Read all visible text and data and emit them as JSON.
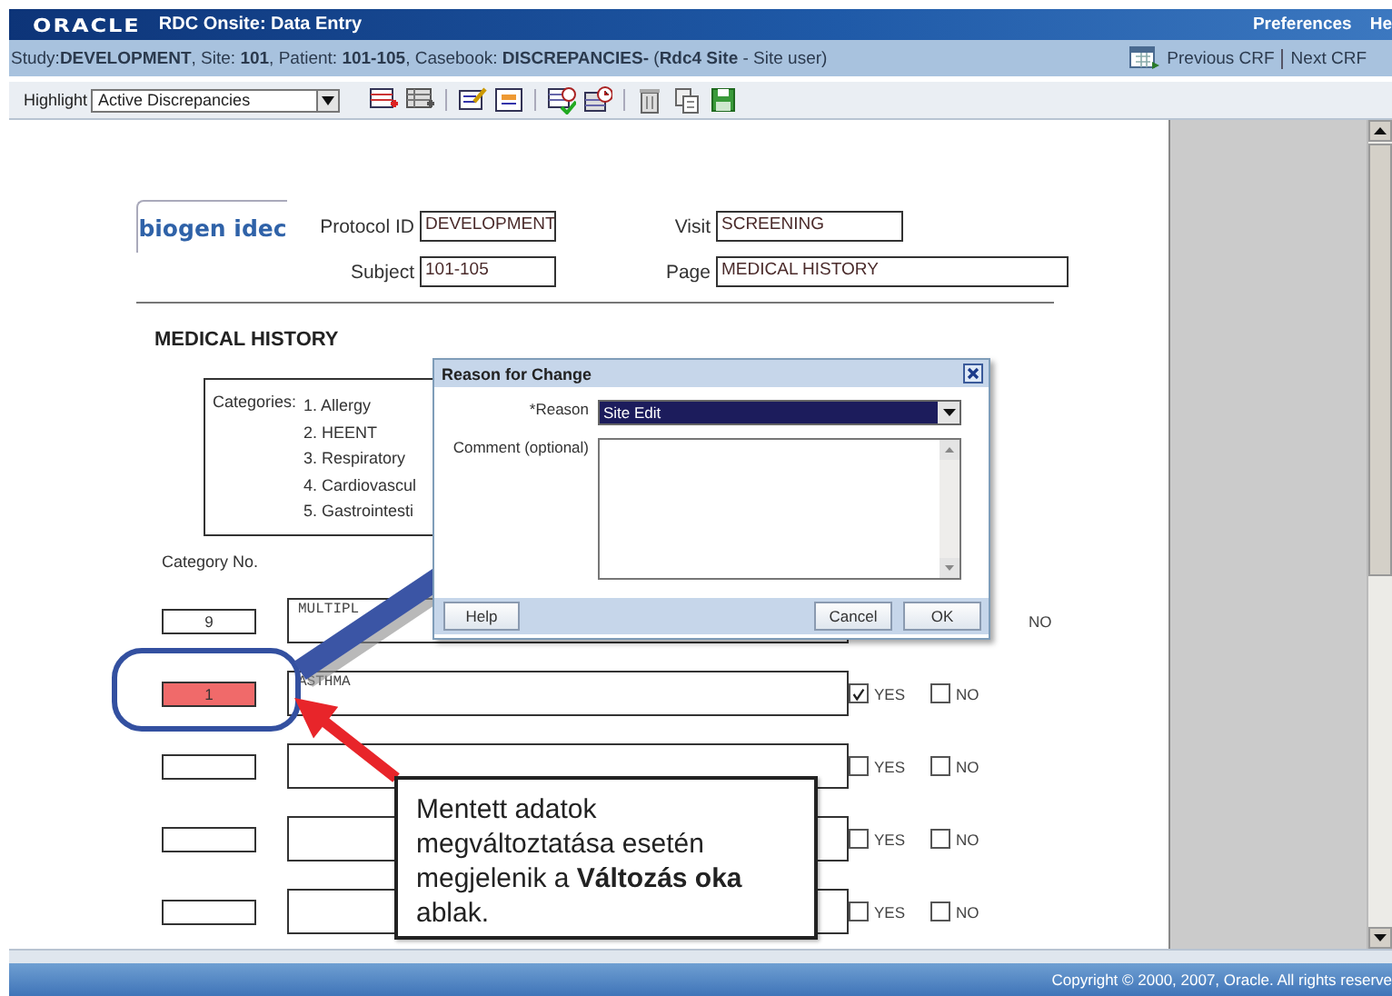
{
  "header": {
    "logo": "ORACLE",
    "title": "RDC Onsite: Data Entry",
    "links": [
      "Preferences",
      "He"
    ]
  },
  "context_bar": {
    "text": "Study:**DEVELOPMENT**, Site: **101**, Patient: **101-105**, Casebook: **DISCREPANCIES-** (**Rdc4 Site** - Site user)",
    "nav": [
      "Previous CRF",
      "Next CRF"
    ]
  },
  "toolbar": {
    "highlight_label": "Highlight",
    "highlight_value": "Active Discrepancies"
  },
  "form": {
    "logo": "biogen idec",
    "fields": [
      {
        "label": "Protocol ID",
        "value": "DEVELOPMENT"
      },
      {
        "label": "Visit",
        "value": "SCREENING"
      },
      {
        "label": "Subject",
        "value": "101-105"
      },
      {
        "label": "Page",
        "value": "MEDICAL HISTORY"
      }
    ],
    "section_title": "MEDICAL HISTORY",
    "categories_label": "Categories:",
    "categories": [
      "1. Allergy",
      "2. HEENT",
      "3. Respiratory",
      "4. Cardiovascul",
      "5. Gastrointesti"
    ],
    "category_no_label": "Category No.",
    "rows": [
      {
        "number": "9",
        "discrepancy": false,
        "description": "MULTIPL",
        "options": [
          {
            "kind": "label",
            "label": "NO"
          }
        ]
      },
      {
        "number": "1",
        "discrepancy": true,
        "description": "ASTHMA",
        "options": [
          {
            "kind": "checkbox",
            "label": "YES",
            "checked": true
          },
          {
            "kind": "checkbox",
            "label": "NO",
            "checked": false
          }
        ]
      },
      {
        "number": "",
        "discrepancy": false,
        "description": "",
        "options": [
          {
            "kind": "checkbox",
            "label": "YES",
            "checked": false
          },
          {
            "kind": "checkbox",
            "label": "NO",
            "checked": false
          }
        ]
      },
      {
        "number": "",
        "discrepancy": false,
        "description": "",
        "options": [
          {
            "kind": "checkbox",
            "label": "YES",
            "checked": false
          },
          {
            "kind": "checkbox",
            "label": "NO",
            "checked": false
          }
        ]
      },
      {
        "number": "",
        "discrepancy": false,
        "description": "",
        "options": [
          {
            "kind": "checkbox",
            "label": "YES",
            "checked": false
          },
          {
            "kind": "checkbox",
            "label": "NO",
            "checked": false
          }
        ]
      }
    ]
  },
  "dialog": {
    "title": "Reason for Change",
    "reason_label": "*Reason",
    "reason_value": "Site Edit",
    "comment_label": "Comment (optional)",
    "buttons": [
      "Help",
      "Cancel",
      "OK"
    ]
  },
  "callout": {
    "text": "Mentett adatok\nmegváltoztatása esetén\nmegjelenik a **Változás oka**\nablak."
  },
  "footer": {
    "copyright": "Copyright © 2000, 2007, Oracle. All rights reserve"
  }
}
